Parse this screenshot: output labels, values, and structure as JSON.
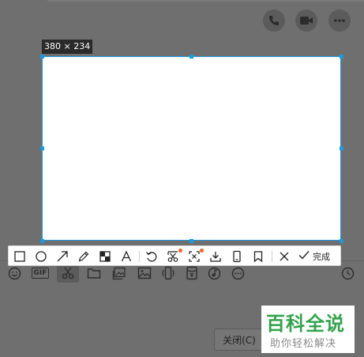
{
  "window": {
    "call_actions": [
      {
        "icon": "phone-icon"
      },
      {
        "icon": "video-call-icon"
      },
      {
        "icon": "more-icon"
      }
    ]
  },
  "capture": {
    "size_label": "380 × 234",
    "accent_color": "#1a9be0"
  },
  "screenshot_toolbar": {
    "tools": [
      {
        "icon": "rectangle-icon"
      },
      {
        "icon": "ellipse-icon"
      },
      {
        "icon": "arrow-icon"
      },
      {
        "icon": "pen-icon"
      },
      {
        "icon": "mosaic-icon"
      },
      {
        "icon": "text-icon"
      },
      {
        "icon": "undo-icon"
      },
      {
        "icon": "smart-cut-icon",
        "badge": true
      },
      {
        "icon": "ocr-icon",
        "badge": true
      },
      {
        "icon": "download-icon"
      },
      {
        "icon": "send-to-phone-icon"
      },
      {
        "icon": "pin-icon"
      },
      {
        "icon": "cancel-icon"
      }
    ],
    "done_label": "完成"
  },
  "input_toolbar": {
    "icons": [
      "emoji-icon",
      "gif-icon",
      "scissors-icon",
      "folder-icon",
      "multi-image-icon",
      "image-icon",
      "shake-icon",
      "red-packet-icon",
      "music-icon",
      "more-icon",
      "history-icon"
    ],
    "gif_label": "GIF"
  },
  "buttons": {
    "close_label": "关闭(C)"
  },
  "watermark": {
    "main": "百科全说",
    "sub": "助你轻松解决"
  }
}
